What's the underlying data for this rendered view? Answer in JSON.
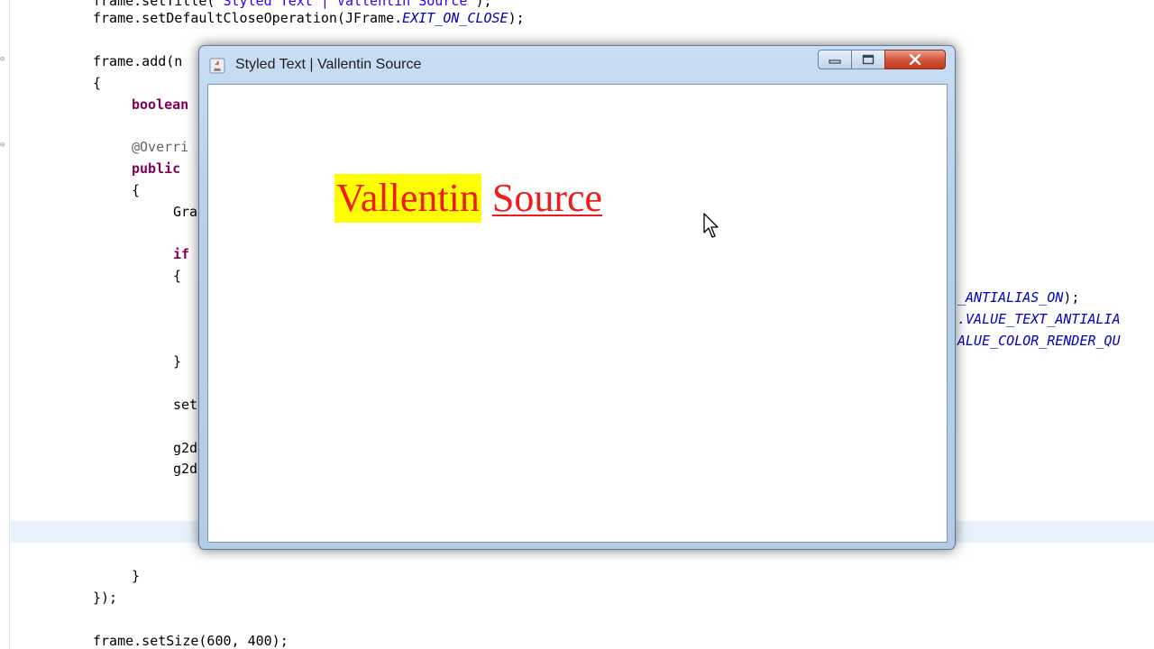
{
  "editor": {
    "lines": [
      {
        "id": "l0",
        "parts": [
          {
            "t": "frame.setTitle(",
            "c": ""
          },
          {
            "t": "\"Styled Text | Vallentin Source\"",
            "c": "str"
          },
          {
            "t": ");",
            "c": ""
          }
        ]
      },
      {
        "id": "l1",
        "parts": [
          {
            "t": "frame.setDefaultCloseOperation(JFrame.",
            "c": ""
          },
          {
            "t": "EXIT_ON_CLOSE",
            "c": "const"
          },
          {
            "t": ");",
            "c": ""
          }
        ]
      },
      {
        "id": "l2",
        "parts": [
          {
            "t": "frame.add(n",
            "c": ""
          }
        ]
      },
      {
        "id": "l3",
        "parts": [
          {
            "t": "{",
            "c": ""
          }
        ]
      },
      {
        "id": "l4",
        "parts": [
          {
            "t": "boolean",
            "c": "kw"
          }
        ]
      },
      {
        "id": "l5",
        "parts": [
          {
            "t": "@Overri",
            "c": "ann"
          }
        ]
      },
      {
        "id": "l6",
        "parts": [
          {
            "t": "public",
            "c": "kw"
          }
        ]
      },
      {
        "id": "l7",
        "parts": [
          {
            "t": "{",
            "c": ""
          }
        ]
      },
      {
        "id": "l8",
        "parts": [
          {
            "t": "Gra",
            "c": ""
          }
        ]
      },
      {
        "id": "l9",
        "parts": [
          {
            "t": "if",
            "c": "kw"
          }
        ]
      },
      {
        "id": "l10",
        "parts": [
          {
            "t": "{",
            "c": ""
          }
        ]
      },
      {
        "id": "l11",
        "parts": [
          {
            "t": "}",
            "c": ""
          }
        ]
      },
      {
        "id": "l12",
        "parts": [
          {
            "t": "set",
            "c": ""
          }
        ]
      },
      {
        "id": "l13",
        "parts": [
          {
            "t": "g2d",
            "c": ""
          }
        ]
      },
      {
        "id": "l14",
        "parts": [
          {
            "t": "g2d",
            "c": ""
          }
        ]
      },
      {
        "id": "l15",
        "parts": [
          {
            "t": "}",
            "c": ""
          }
        ]
      },
      {
        "id": "l16",
        "parts": [
          {
            "t": "});",
            "c": ""
          }
        ]
      },
      {
        "id": "l17",
        "parts": [
          {
            "t": "frame.setSize(600, 400);",
            "c": ""
          }
        ]
      },
      {
        "id": "r0",
        "parts": [
          {
            "t": "_ANTIALIAS_ON",
            "c": "const"
          },
          {
            "t": ");",
            "c": ""
          }
        ]
      },
      {
        "id": "r1",
        "parts": [
          {
            "t": ".VALUE_TEXT_ANTIALIA",
            "c": "const"
          }
        ]
      },
      {
        "id": "r2",
        "parts": [
          {
            "t": "ALUE_COLOR_RENDER_QU",
            "c": "const"
          }
        ]
      }
    ]
  },
  "window": {
    "title": "Styled Text | Vallentin Source",
    "minimize_glyph": "▭",
    "maximize_glyph": "▢",
    "close_glyph": "✕",
    "content": {
      "word1": "Vallentin",
      "word2": "Source",
      "text_color": "#ee1c1c",
      "highlight_color": "#ffff00"
    }
  }
}
